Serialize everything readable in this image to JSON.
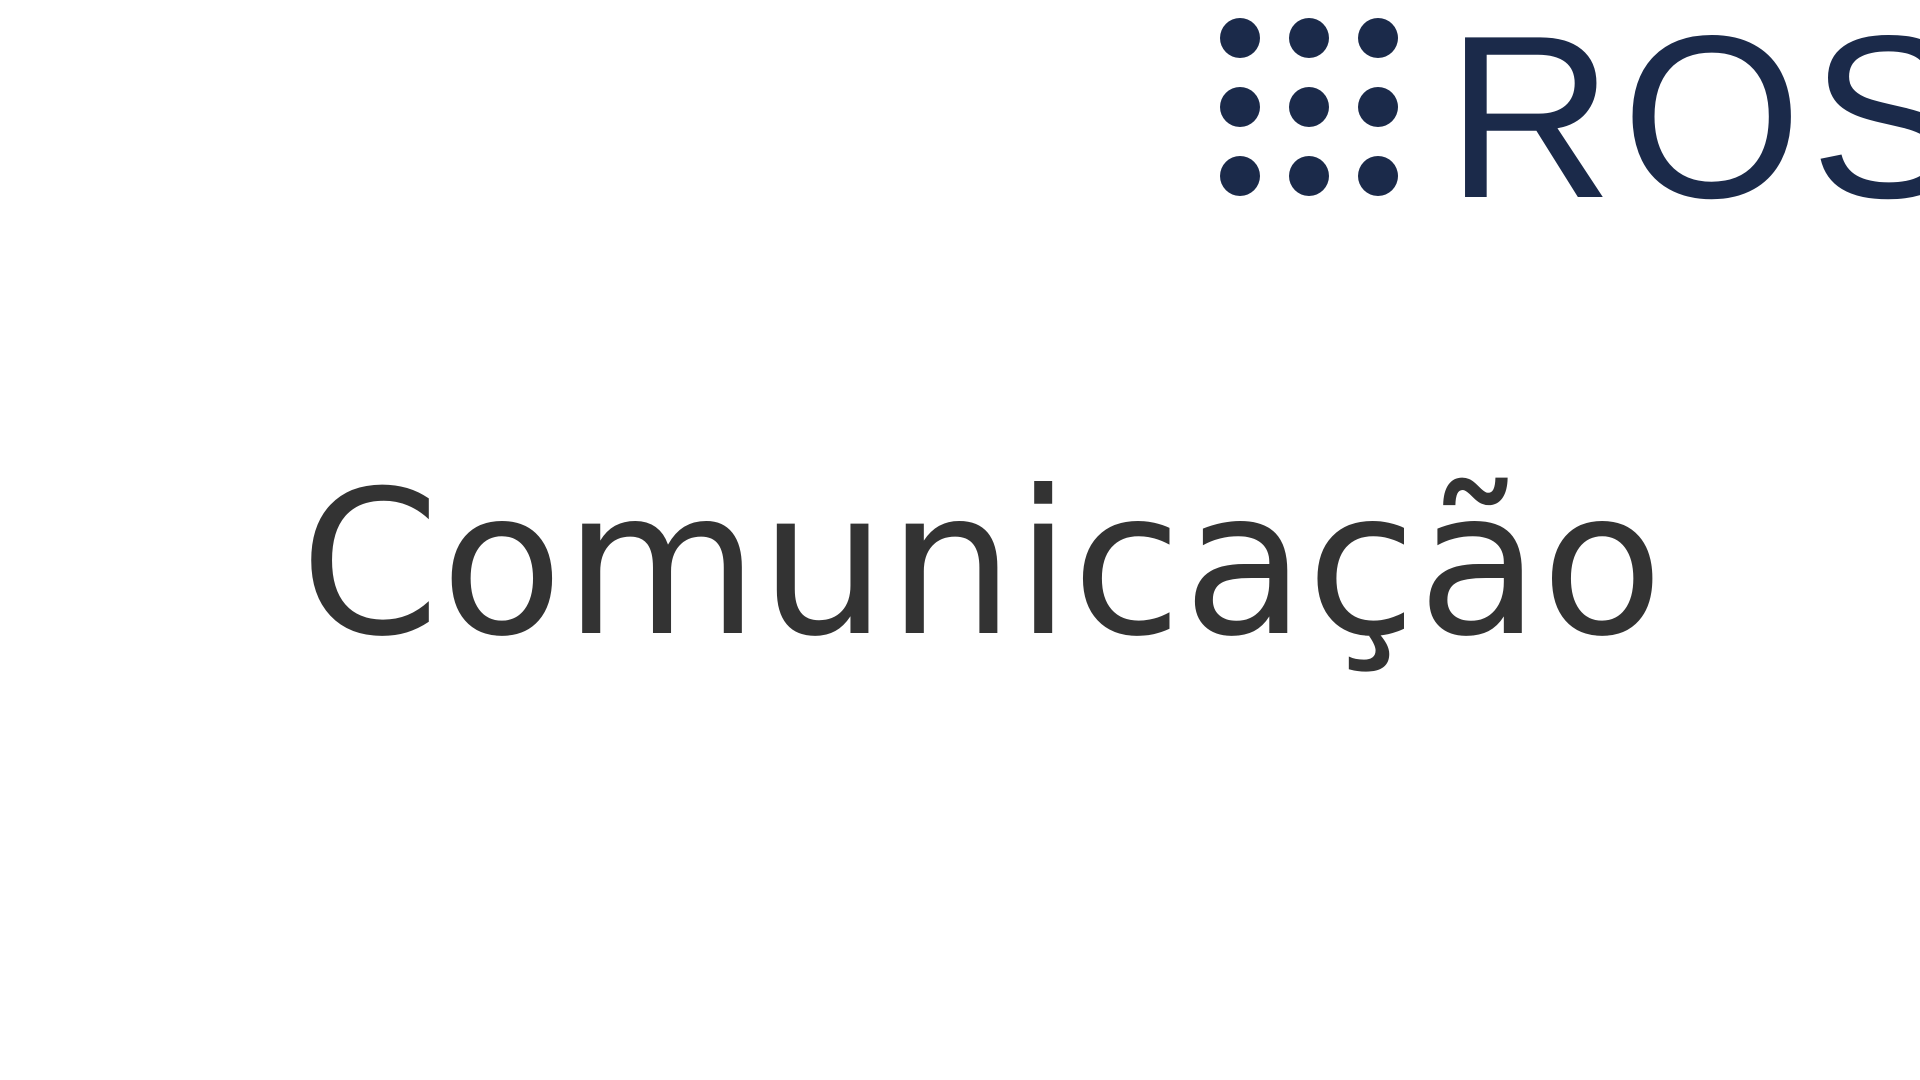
{
  "slide": {
    "title": "Comunicação",
    "title_color": "#333333"
  },
  "logo": {
    "text": "ROS",
    "icon": "nine-dot-grid-icon",
    "color": "#1b2a4a"
  }
}
